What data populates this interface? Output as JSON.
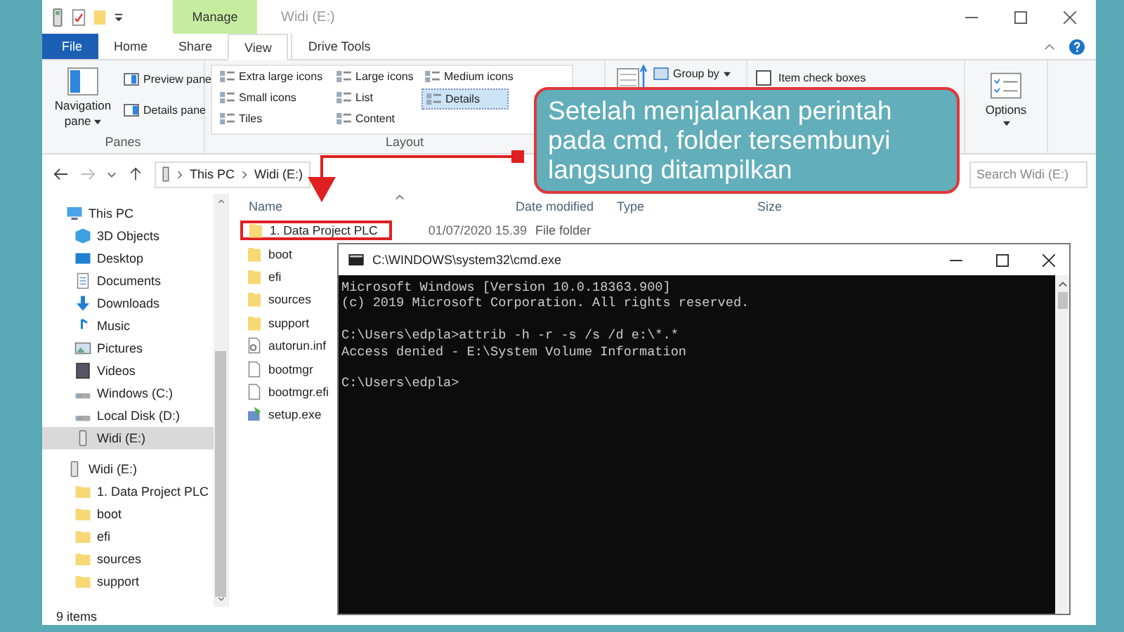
{
  "window": {
    "title": "Widi (E:)",
    "context_tab": "Manage"
  },
  "tabs": [
    {
      "label": "File",
      "kind": "file",
      "selected": false
    },
    {
      "label": "Home",
      "kind": "tab",
      "selected": false
    },
    {
      "label": "Share",
      "kind": "tab",
      "selected": false
    },
    {
      "label": "View",
      "kind": "tab",
      "selected": true
    },
    {
      "label": "Drive Tools",
      "kind": "context",
      "selected": false
    }
  ],
  "ribbon": {
    "panes": {
      "label": "Panes",
      "navigation_pane": "Navigation pane",
      "items": [
        "Preview pane",
        "Details pane"
      ]
    },
    "layout": {
      "label": "Layout",
      "options": [
        {
          "label": "Extra large icons",
          "selected": false
        },
        {
          "label": "Large icons",
          "selected": false
        },
        {
          "label": "Medium icons",
          "selected": false
        },
        {
          "label": "Small icons",
          "selected": false
        },
        {
          "label": "List",
          "selected": false
        },
        {
          "label": "Details",
          "selected": true
        },
        {
          "label": "Tiles",
          "selected": false
        },
        {
          "label": "Content",
          "selected": false
        }
      ]
    },
    "group_by": "Group by",
    "item_check_boxes": {
      "label": "Item check boxes",
      "checked": false
    },
    "options": "Options"
  },
  "address": {
    "path": [
      "This PC",
      "Widi (E:)"
    ],
    "search_placeholder": "Search Widi (E:)"
  },
  "nav": [
    {
      "label": "This PC",
      "kind": "pc",
      "selected": false,
      "children": [
        {
          "label": "3D Objects",
          "kind": "cube",
          "selected": false
        },
        {
          "label": "Desktop",
          "kind": "desktop",
          "selected": false
        },
        {
          "label": "Documents",
          "kind": "documents",
          "selected": false
        },
        {
          "label": "Downloads",
          "kind": "downloads",
          "selected": false
        },
        {
          "label": "Music",
          "kind": "music",
          "selected": false
        },
        {
          "label": "Pictures",
          "kind": "pictures",
          "selected": false
        },
        {
          "label": "Videos",
          "kind": "videos",
          "selected": false
        },
        {
          "label": "Windows (C:)",
          "kind": "drive",
          "selected": false
        },
        {
          "label": "Local Disk (D:)",
          "kind": "drive",
          "selected": false
        },
        {
          "label": "Widi (E:)",
          "kind": "usb",
          "selected": true
        }
      ]
    },
    {
      "label": "Widi (E:)",
      "kind": "usb",
      "selected": false,
      "children": [
        {
          "label": "1. Data Project PLC",
          "kind": "folder",
          "selected": false
        },
        {
          "label": "boot",
          "kind": "folder",
          "selected": false
        },
        {
          "label": "efi",
          "kind": "folder",
          "selected": false
        },
        {
          "label": "sources",
          "kind": "folder",
          "selected": false
        },
        {
          "label": "support",
          "kind": "folder",
          "selected": false
        }
      ]
    }
  ],
  "files": {
    "columns": [
      "Name",
      "Date modified",
      "Type",
      "Size"
    ],
    "rows": [
      {
        "name": "1. Data Project PLC",
        "kind": "folder",
        "date": "01/07/2020 15.39",
        "type": "File folder",
        "highlighted": true
      },
      {
        "name": "boot",
        "kind": "folder",
        "highlighted": false
      },
      {
        "name": "efi",
        "kind": "folder",
        "highlighted": false
      },
      {
        "name": "sources",
        "kind": "folder",
        "highlighted": false
      },
      {
        "name": "support",
        "kind": "folder",
        "highlighted": false
      },
      {
        "name": "autorun.inf",
        "kind": "settings-file",
        "highlighted": false
      },
      {
        "name": "bootmgr",
        "kind": "file",
        "highlighted": false
      },
      {
        "name": "bootmgr.efi",
        "kind": "file",
        "highlighted": false
      },
      {
        "name": "setup.exe",
        "kind": "installer",
        "highlighted": false
      }
    ]
  },
  "status": "9 items",
  "cmd": {
    "title": "C:\\WINDOWS\\system32\\cmd.exe",
    "blocks": [
      [
        "Microsoft Windows [Version 10.0.18363.900]",
        "(c) 2019 Microsoft Corporation. All rights reserved."
      ],
      [
        "C:\\Users\\edpla>attrib -h -r -s /s /d e:\\*.*",
        "Access denied - E:\\System Volume Information"
      ],
      [
        "C:\\Users\\edpla>"
      ]
    ]
  },
  "callout": "Setelah menjalankan perintah pada cmd, folder tersembunyi langsung ditampilkan"
}
